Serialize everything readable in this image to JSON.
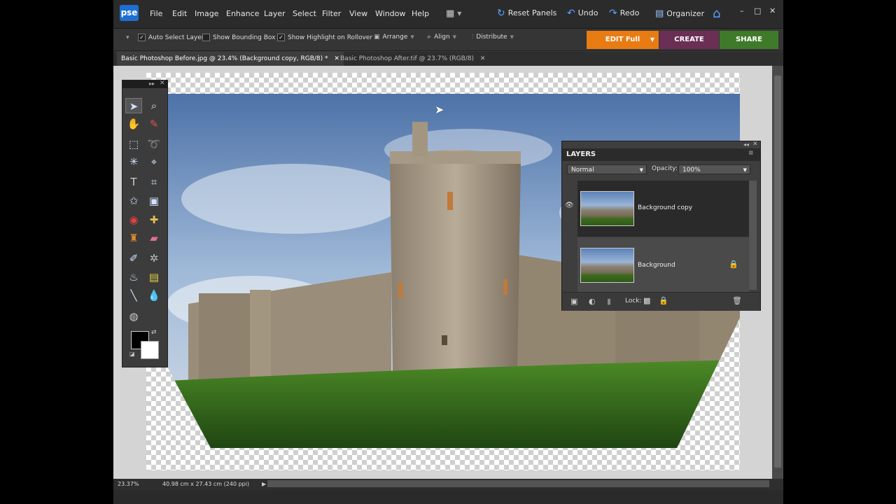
{
  "app": {
    "logo": "pse"
  },
  "menu": [
    "File",
    "Edit",
    "Image",
    "Enhance",
    "Layer",
    "Select",
    "Filter",
    "View",
    "Window",
    "Help"
  ],
  "menu_buttons": {
    "reset_panels": "Reset Panels",
    "undo": "Undo",
    "redo": "Redo",
    "organizer": "Organizer"
  },
  "window_controls": {
    "minimize": "–",
    "restore": "□",
    "close": "✕"
  },
  "options": {
    "auto_select_layer": {
      "label": "Auto Select Layer",
      "checked": true
    },
    "show_bounding_box": {
      "label": "Show Bounding Box",
      "checked": false
    },
    "show_highlight": {
      "label": "Show Highlight on Rollover",
      "checked": true
    },
    "arrange": "Arrange",
    "align": "Align",
    "distribute": "Distribute"
  },
  "mode_tabs": {
    "edit": "EDIT Full",
    "create": "CREATE",
    "share": "SHARE"
  },
  "doc_tabs": [
    {
      "label": "Basic Photoshop Before.jpg @ 23.4% (Background copy, RGB/8) *",
      "active": true
    },
    {
      "label": "Basic Photoshop After.tif @ 23.7% (RGB/8)",
      "active": false
    }
  ],
  "status": {
    "zoom": "23.37%",
    "doc_size": "40.98 cm x 27.43 cm (240 ppi)"
  },
  "layers_panel": {
    "title": "LAYERS",
    "blend_mode": "Normal",
    "opacity_label": "Opacity:",
    "opacity_value": "100%",
    "layers": [
      {
        "name": "Background copy",
        "visible": true,
        "locked": false,
        "selected": true
      },
      {
        "name": "Background",
        "visible": false,
        "locked": true,
        "selected": false
      }
    ],
    "lock_label": "Lock:"
  },
  "colors": {
    "edit_tab": "#e87c13",
    "create_tab": "#6b2f55",
    "share_tab": "#3f7a2a",
    "accent": "#1e6fd0"
  }
}
